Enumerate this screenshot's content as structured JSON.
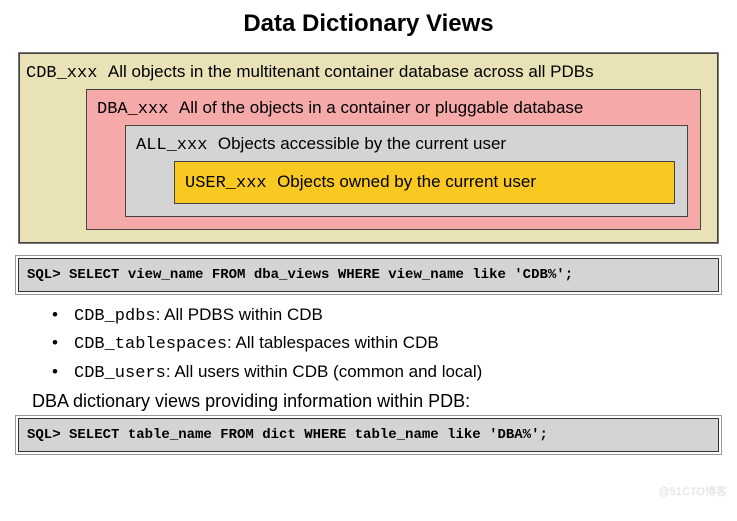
{
  "title": "Data Dictionary Views",
  "boxes": {
    "cdb": {
      "prefix": "CDB_xxx",
      "desc": "All objects in the multitenant container database across all PDBs"
    },
    "dba": {
      "prefix": "DBA_xxx",
      "desc": "All of the objects in a container or pluggable database"
    },
    "all": {
      "prefix": "ALL_xxx",
      "desc": "Objects accessible by the current user"
    },
    "user": {
      "prefix": "USER_xxx",
      "desc": "Objects owned by the current user"
    }
  },
  "sql1": "SQL> SELECT view_name FROM dba_views WHERE view_name like 'CDB%';",
  "list": [
    {
      "name": "CDB_pdbs",
      "desc": ": All PDBS within CDB"
    },
    {
      "name": "CDB_tablespaces",
      "desc": ": All tablespaces within CDB"
    },
    {
      "name": "CDB_users",
      "desc": ": All users within CDB (common and local)"
    }
  ],
  "footer": "DBA dictionary views providing information within PDB:",
  "sql2": "SQL> SELECT table_name FROM dict WHERE table_name like 'DBA%';",
  "watermark": "@51CTO博客"
}
